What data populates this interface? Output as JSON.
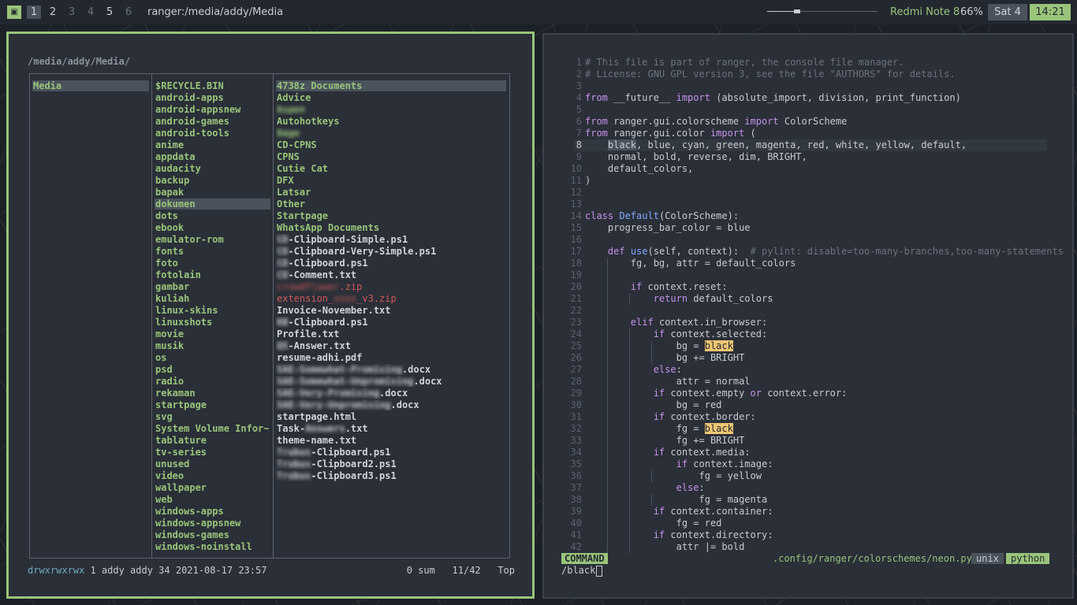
{
  "topbar": {
    "layout_icon": "tile-layout-icon",
    "workspaces": [
      {
        "label": "1",
        "state": "active"
      },
      {
        "label": "2",
        "state": "normal"
      },
      {
        "label": "3",
        "state": "empty"
      },
      {
        "label": "4",
        "state": "empty"
      },
      {
        "label": "5",
        "state": "normal"
      },
      {
        "label": "6",
        "state": "empty"
      }
    ],
    "window_title": "ranger:/media/addy/Media",
    "volume_fraction": 0.27,
    "device": "Redmi Note 8",
    "battery": "66%",
    "date": "Sat 4",
    "time": "14:21"
  },
  "ranger": {
    "path": "/media/addy/Media/",
    "parent": [
      "Media"
    ],
    "dirs": [
      "$RECYCLE.BIN",
      "android-apps",
      "android-appsnew",
      "android-games",
      "android-tools",
      "anime",
      "appdata",
      "audacity",
      "backup",
      "bapak",
      "dokumen",
      "dots",
      "ebook",
      "emulator-rom",
      "fonts",
      "foto",
      "fotolain",
      "gambar",
      "kuliah",
      "linux-skins",
      "linuxshots",
      "movie",
      "musik",
      "os",
      "psd",
      "radio",
      "rekaman",
      "startpage",
      "svg",
      "System Volume Infor~",
      "tablature",
      "tv-series",
      "unused",
      "video",
      "wallpaper",
      "web",
      "windows-apps",
      "windows-appsnew",
      "windows-games",
      "windows-noinstall"
    ],
    "dirs_selected_index": 10,
    "preview": [
      {
        "pre": "",
        "blur": "",
        "post": "4738z Documents",
        "kind": "dir"
      },
      {
        "pre": "",
        "blur": "",
        "post": "Advice",
        "kind": "dir"
      },
      {
        "pre": "",
        "blur": "Aspen",
        "post": "",
        "kind": "dir"
      },
      {
        "pre": "",
        "blur": "",
        "post": "Autohotkeys",
        "kind": "dir"
      },
      {
        "pre": "",
        "blur": "Bage",
        "post": "",
        "kind": "dir"
      },
      {
        "pre": "",
        "blur": "",
        "post": "CD-CPNS",
        "kind": "dir"
      },
      {
        "pre": "",
        "blur": "",
        "post": "CPNS",
        "kind": "dir"
      },
      {
        "pre": "",
        "blur": "",
        "post": "Cutie Cat",
        "kind": "dir"
      },
      {
        "pre": "",
        "blur": "",
        "post": "DFX",
        "kind": "dir"
      },
      {
        "pre": "",
        "blur": "",
        "post": "Latsar",
        "kind": "dir"
      },
      {
        "pre": "",
        "blur": "",
        "post": "Other",
        "kind": "dir"
      },
      {
        "pre": "",
        "blur": "",
        "post": "Startpage",
        "kind": "dir"
      },
      {
        "pre": "",
        "blur": "",
        "post": "WhatsApp Documents",
        "kind": "dir"
      },
      {
        "pre": "",
        "blur": "CD",
        "post": "-Clipboard-Simple.ps1",
        "kind": "file"
      },
      {
        "pre": "",
        "blur": "CD",
        "post": "-Clipboard-Very-Simple.ps1",
        "kind": "file"
      },
      {
        "pre": "",
        "blur": "CD",
        "post": "-Clipboard.ps1",
        "kind": "file"
      },
      {
        "pre": "",
        "blur": "CD",
        "post": "-Comment.txt",
        "kind": "file"
      },
      {
        "pre": "",
        "blur": "crowdflower",
        "post": ".zip",
        "kind": "red"
      },
      {
        "pre": "extension_",
        "blur": "xxxx",
        "post": "_v3.zip",
        "kind": "red"
      },
      {
        "pre": "",
        "blur": "",
        "post": "Invoice-November.txt",
        "kind": "file"
      },
      {
        "pre": "",
        "blur": "KB",
        "post": "-Clipboard.ps1",
        "kind": "file"
      },
      {
        "pre": "",
        "blur": "",
        "post": "Profile.txt",
        "kind": "file"
      },
      {
        "pre": "",
        "blur": "QS",
        "post": "-Answer.txt",
        "kind": "file"
      },
      {
        "pre": "",
        "blur": "",
        "post": "resume-adhi.pdf",
        "kind": "file"
      },
      {
        "pre": "",
        "blur": "SAE-Somewhat-Promising",
        "post": ".docx",
        "kind": "file"
      },
      {
        "pre": "",
        "blur": "SAE-Somewhat-Unpromising",
        "post": ".docx",
        "kind": "file"
      },
      {
        "pre": "",
        "blur": "SAE-Very-Promising",
        "post": ".docx",
        "kind": "file"
      },
      {
        "pre": "",
        "blur": "SAE-Very-Unpromising",
        "post": ".docx",
        "kind": "file"
      },
      {
        "pre": "",
        "blur": "",
        "post": "startpage.html",
        "kind": "file"
      },
      {
        "pre": "Task-",
        "blur": "Answers",
        "post": ".txt",
        "kind": "file"
      },
      {
        "pre": "",
        "blur": "",
        "post": "theme-name.txt",
        "kind": "file"
      },
      {
        "pre": "",
        "blur": "Trubus",
        "post": "-Clipboard.ps1",
        "kind": "file"
      },
      {
        "pre": "",
        "blur": "Trubus",
        "post": "-Clipboard2.ps1",
        "kind": "file"
      },
      {
        "pre": "",
        "blur": "Trubus",
        "post": "-Clipboard3.ps1",
        "kind": "file"
      }
    ],
    "status": {
      "perms": "drwxrwxrwx",
      "meta": "1 addy addy 34 2021-08-17 23:57",
      "right": "0 sum   11/42   Top"
    }
  },
  "vim": {
    "lines": [
      [
        {
          "t": "# This file is part of ranger, the console file manager.",
          "c": "cmt"
        }
      ],
      [
        {
          "t": "# License: GNU GPL version 3, see the file \"AUTHORS\" for details.",
          "c": "cmt"
        }
      ],
      [],
      [
        {
          "t": "from",
          "c": "kw"
        },
        {
          "t": " __future__ "
        },
        {
          "t": "import",
          "c": "kw"
        },
        {
          "t": " (absolute_import, division, print_function)"
        }
      ],
      [],
      [
        {
          "t": "from",
          "c": "kw"
        },
        {
          "t": " ranger.gui.colorscheme "
        },
        {
          "t": "import",
          "c": "kw"
        },
        {
          "t": " ColorScheme"
        }
      ],
      [
        {
          "t": "from",
          "c": "kw"
        },
        {
          "t": " ranger.gui.color "
        },
        {
          "t": "import",
          "c": "kw"
        },
        {
          "t": " ("
        }
      ],
      [
        {
          "t": "    "
        },
        {
          "t": "black",
          "c": "cur"
        },
        {
          "t": ", blue, cyan, green, magenta, red, white, yellow, default,"
        }
      ],
      [
        {
          "t": "    normal, bold, reverse, dim, BRIGHT,"
        }
      ],
      [
        {
          "t": "    default_colors,"
        }
      ],
      [
        {
          "t": ")"
        }
      ],
      [],
      [],
      [
        {
          "t": "class",
          "c": "kw"
        },
        {
          "t": " "
        },
        {
          "t": "Default",
          "c": "fn"
        },
        {
          "t": "(ColorScheme):"
        }
      ],
      [
        {
          "t": "    progress_bar_color = blue"
        }
      ],
      [],
      [
        {
          "t": "    "
        },
        {
          "t": "def",
          "c": "kw"
        },
        {
          "t": " "
        },
        {
          "t": "use",
          "c": "fn"
        },
        {
          "t": "(self, context):  "
        },
        {
          "t": "# pylint: disable=too-many-branches,too-many-statements",
          "c": "cmt"
        }
      ],
      [
        {
          "t": "        fg, bg, attr = default_colors"
        }
      ],
      [],
      [
        {
          "t": "        "
        },
        {
          "t": "if",
          "c": "kw"
        },
        {
          "t": " context.reset:"
        }
      ],
      [
        {
          "t": "            "
        },
        {
          "t": "return",
          "c": "kw"
        },
        {
          "t": " default_colors"
        }
      ],
      [],
      [
        {
          "t": "        "
        },
        {
          "t": "elif",
          "c": "kw"
        },
        {
          "t": " context.in_browser:"
        }
      ],
      [
        {
          "t": "            "
        },
        {
          "t": "if",
          "c": "kw"
        },
        {
          "t": " context.selected:"
        }
      ],
      [
        {
          "t": "                bg = "
        },
        {
          "t": "black",
          "c": "hl"
        }
      ],
      [
        {
          "t": "                bg += BRIGHT"
        }
      ],
      [
        {
          "t": "            "
        },
        {
          "t": "else",
          "c": "kw"
        },
        {
          "t": ":"
        }
      ],
      [
        {
          "t": "                attr = normal"
        }
      ],
      [
        {
          "t": "            "
        },
        {
          "t": "if",
          "c": "kw"
        },
        {
          "t": " context.empty "
        },
        {
          "t": "or",
          "c": "kw"
        },
        {
          "t": " context.error:"
        }
      ],
      [
        {
          "t": "                bg = red"
        }
      ],
      [
        {
          "t": "            "
        },
        {
          "t": "if",
          "c": "kw"
        },
        {
          "t": " context.border:"
        }
      ],
      [
        {
          "t": "                fg = "
        },
        {
          "t": "black",
          "c": "hl"
        }
      ],
      [
        {
          "t": "                fg += BRIGHT"
        }
      ],
      [
        {
          "t": "            "
        },
        {
          "t": "if",
          "c": "kw"
        },
        {
          "t": " context.media:"
        }
      ],
      [
        {
          "t": "                "
        },
        {
          "t": "if",
          "c": "kw"
        },
        {
          "t": " context.image:"
        }
      ],
      [
        {
          "t": "                    fg = yellow"
        }
      ],
      [
        {
          "t": "                "
        },
        {
          "t": "else",
          "c": "kw"
        },
        {
          "t": ":"
        }
      ],
      [
        {
          "t": "                    fg = magenta"
        }
      ],
      [
        {
          "t": "            "
        },
        {
          "t": "if",
          "c": "kw"
        },
        {
          "t": " context.container:"
        }
      ],
      [
        {
          "t": "                fg = red"
        }
      ],
      [
        {
          "t": "            "
        },
        {
          "t": "if",
          "c": "kw"
        },
        {
          "t": " context.directory:"
        }
      ],
      [
        {
          "t": "                attr |= bold"
        }
      ]
    ],
    "cursor_line": 8,
    "status": {
      "mode": "COMMAND",
      "file": ".config/ranger/colorschemes/neon.py",
      "fileformat": "unix",
      "filetype": "python"
    },
    "cmdline": "/black"
  }
}
